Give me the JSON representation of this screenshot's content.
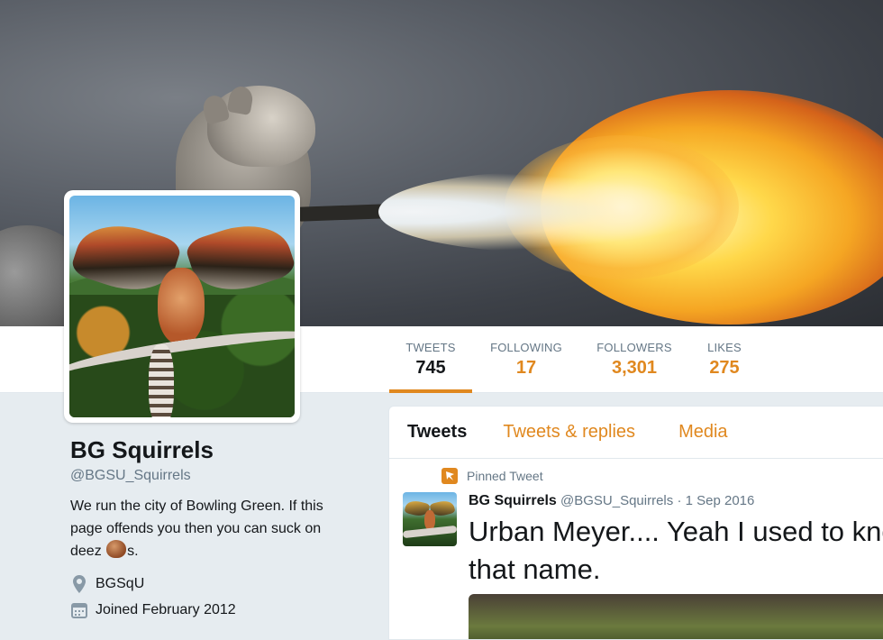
{
  "stats": [
    {
      "label": "TWEETS",
      "value": "745"
    },
    {
      "label": "FOLLOWING",
      "value": "17"
    },
    {
      "label": "FOLLOWERS",
      "value": "3,301"
    },
    {
      "label": "LIKES",
      "value": "275"
    }
  ],
  "profile": {
    "name": "BG Squirrels",
    "handle": "@BGSU_Squirrels",
    "bio_line1": "We run the city of Bowling Green. If this",
    "bio_line2": "page offends you then you can suck on",
    "bio_pre": "deez",
    "bio_post": "s.",
    "location": "BGSqU",
    "joined": "Joined February 2012"
  },
  "timeline": {
    "tabs": [
      "Tweets",
      "Tweets & replies",
      "Media"
    ],
    "pinned_label": "Pinned Tweet",
    "tweet": {
      "name": "BG Squirrels",
      "handle": "@BGSU_Squirrels",
      "sep": "·",
      "date": "1 Sep 2016",
      "text": "Urban Meyer.... Yeah I used to know that name."
    }
  },
  "colors": {
    "accent": "#e0881f",
    "text": "#14171a",
    "muted": "#657786",
    "background": "#e6ecf0"
  },
  "icons": [
    "location-pin-icon",
    "calendar-icon",
    "pin-icon",
    "nut-emoji-icon"
  ]
}
